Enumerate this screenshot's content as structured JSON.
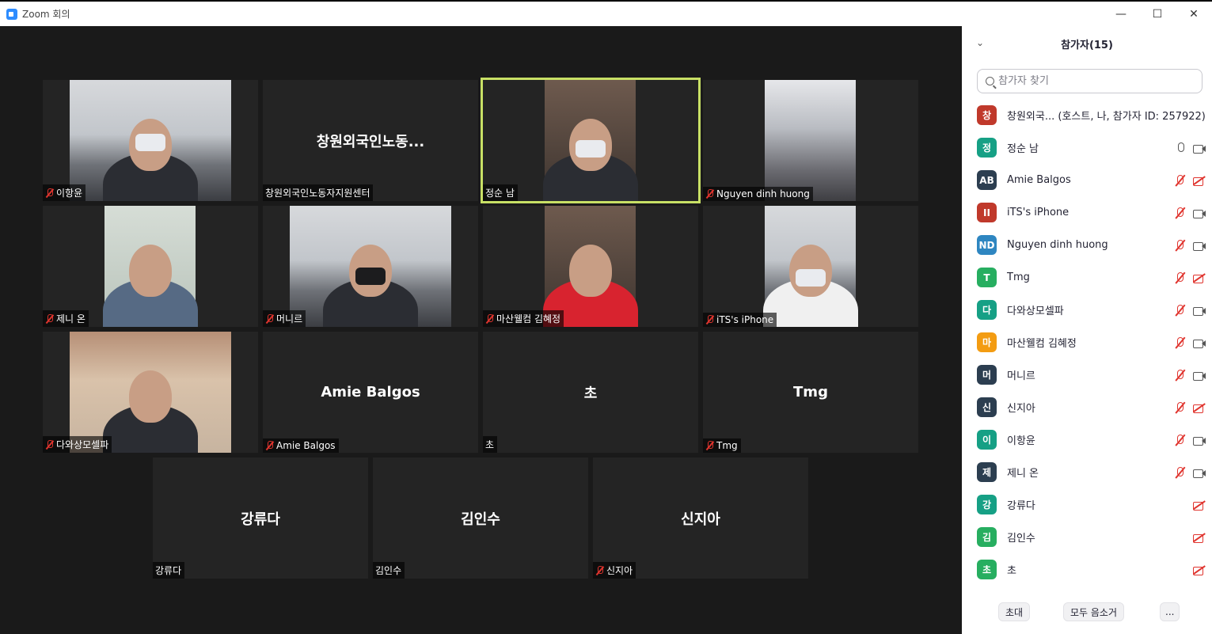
{
  "window": {
    "title": "Zoom 회의",
    "minimize": "—",
    "maximize": "☐",
    "close": "✕"
  },
  "gallery": {
    "tiles": [
      {
        "name": "이항윤",
        "display": "",
        "muted": true
      },
      {
        "name": "창원외국인노동자지원센터",
        "display": "창원외국인노동...",
        "muted": false
      },
      {
        "name": "정순 남",
        "display": "",
        "muted": false,
        "active": true
      },
      {
        "name": "Nguyen dinh huong",
        "display": "",
        "muted": true
      },
      {
        "name": "제니 온",
        "display": "",
        "muted": true
      },
      {
        "name": "머니르",
        "display": "",
        "muted": true
      },
      {
        "name": "마산웰컴 김혜정",
        "display": "",
        "muted": true
      },
      {
        "name": "iTS's iPhone",
        "display": "",
        "muted": true
      },
      {
        "name": "다와상모셀파",
        "display": "",
        "muted": true
      },
      {
        "name": "Amie Balgos",
        "display": "Amie Balgos",
        "muted": true
      },
      {
        "name": "초",
        "display": "초",
        "muted": false
      },
      {
        "name": "Tmg",
        "display": "Tmg",
        "muted": true
      },
      {
        "name": "강류다",
        "display": "강류다",
        "muted": false
      },
      {
        "name": "김인수",
        "display": "김인수",
        "muted": false
      },
      {
        "name": "신지아",
        "display": "신지아",
        "muted": true
      }
    ]
  },
  "panel": {
    "title": "참가자(15)",
    "search_placeholder": "참가자 찾기",
    "participants": [
      {
        "initials": "창",
        "name": "창원외국...  (호스트, 나, 참가자 ID: 257922)",
        "color": "#c0392b",
        "mic": "none",
        "cam": "none"
      },
      {
        "initials": "정",
        "name": "정순 남",
        "color": "#16a085",
        "mic": "on",
        "cam": "on"
      },
      {
        "initials": "AB",
        "name": "Amie Balgos",
        "color": "#2c3e50",
        "mic": "off",
        "cam": "off"
      },
      {
        "initials": "II",
        "name": "iTS's iPhone",
        "color": "#c0392b",
        "mic": "off",
        "cam": "on"
      },
      {
        "initials": "ND",
        "name": "Nguyen dinh huong",
        "color": "#2e86c1",
        "mic": "off",
        "cam": "on"
      },
      {
        "initials": "T",
        "name": "Tmg",
        "color": "#27ae60",
        "mic": "off",
        "cam": "off"
      },
      {
        "initials": "다",
        "name": "다와상모셀파",
        "color": "#16a085",
        "mic": "off",
        "cam": "on"
      },
      {
        "initials": "마",
        "name": "마산웰컴 김혜정",
        "color": "#f39c12",
        "mic": "off",
        "cam": "on"
      },
      {
        "initials": "머",
        "name": "머니르",
        "color": "#2c3e50",
        "mic": "off",
        "cam": "on"
      },
      {
        "initials": "신",
        "name": "신지아",
        "color": "#2c3e50",
        "mic": "off",
        "cam": "off"
      },
      {
        "initials": "이",
        "name": "이항윤",
        "color": "#16a085",
        "mic": "off",
        "cam": "on"
      },
      {
        "initials": "제",
        "name": "제니 온",
        "color": "#2c3e50",
        "mic": "off",
        "cam": "on"
      },
      {
        "initials": "강",
        "name": "강류다",
        "color": "#16a085",
        "mic": "none",
        "cam": "off"
      },
      {
        "initials": "김",
        "name": "김인수",
        "color": "#27ae60",
        "mic": "none",
        "cam": "off"
      },
      {
        "initials": "초",
        "name": "초",
        "color": "#27ae60",
        "mic": "none",
        "cam": "off"
      }
    ],
    "footer": {
      "invite": "초대",
      "mute_all": "모두 음소거",
      "more": "..."
    }
  }
}
